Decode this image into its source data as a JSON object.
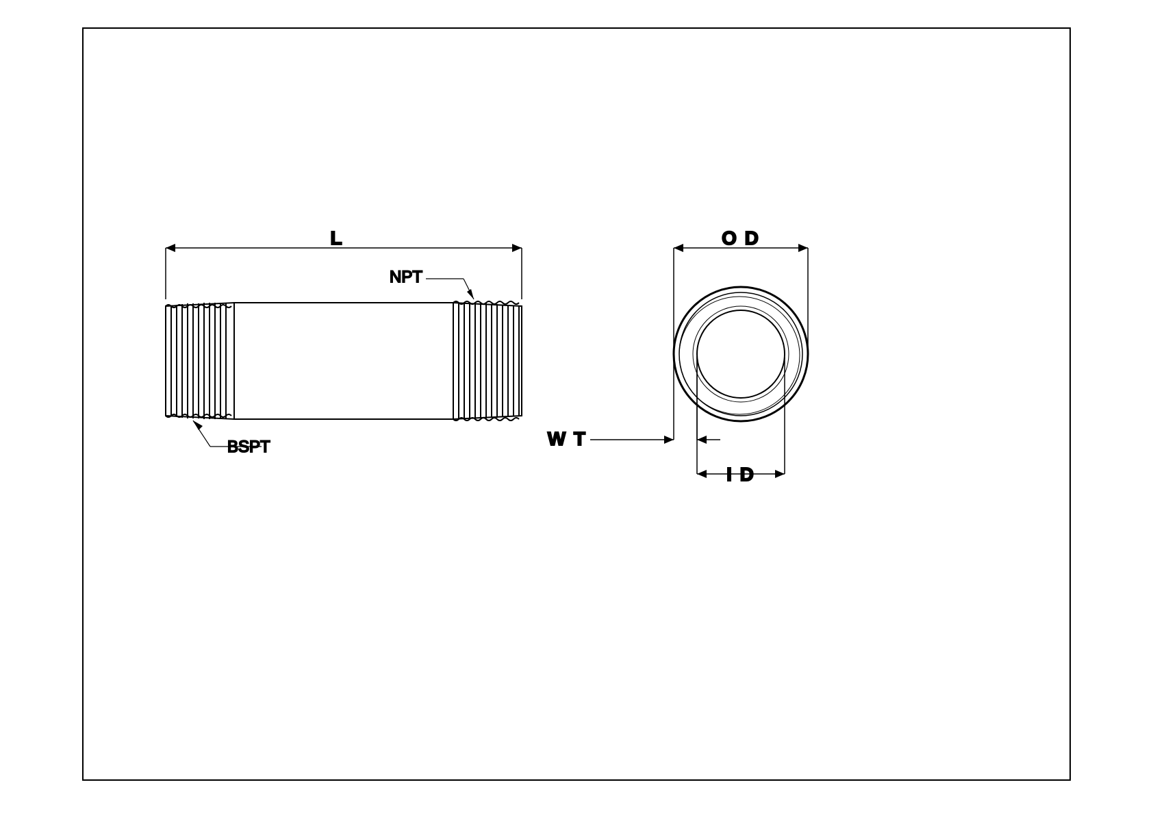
{
  "labels": {
    "L": "L",
    "NPT": "NPT",
    "BSPT": "BSPT",
    "OD": "O D",
    "WT": "W T",
    "ID": "I D"
  }
}
